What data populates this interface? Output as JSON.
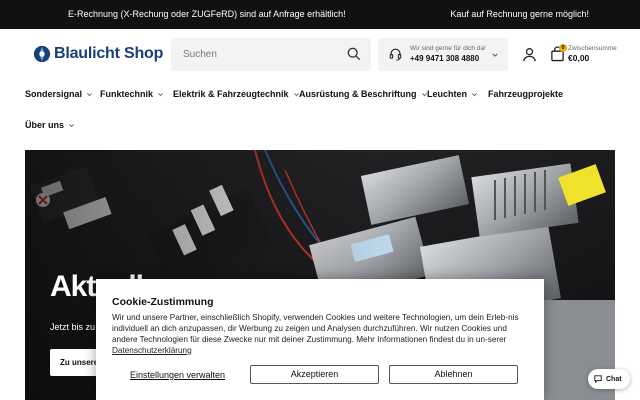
{
  "announcement": {
    "left": "E-Rechnung (X-Rechung oder ZUGFeRD) sind auf Anfrage erhältlich!",
    "right": "Kauf auf Rechnung gerne möglich!"
  },
  "header": {
    "logo_text": "Blaulicht Shop",
    "search_placeholder": "Suchen",
    "contact_label": "Wir sind gerne für dich da!",
    "contact_phone": "+49 9471 308 4880",
    "cart_badge": "0",
    "cart_label": "Zwischensumme",
    "cart_amount": "€0,00"
  },
  "nav": {
    "items": [
      {
        "label": "Sondersignal"
      },
      {
        "label": "Funktechnik"
      },
      {
        "label": "Elektrik & Fahrzeugtechnik"
      },
      {
        "label": "Ausrüstung & Beschriftung"
      },
      {
        "label": "Leuchten"
      },
      {
        "label": "Fahrzeugprojekte"
      },
      {
        "label": "Über uns"
      }
    ]
  },
  "hero": {
    "title": "Aktuelles",
    "subtitle": "Jetzt bis zu",
    "button_label": "Zu unseren Angeboten"
  },
  "cookie": {
    "title": "Cookie-Zustimmung",
    "text": "Wir und unsere Partner, einschließlich Shopify, verwenden Cookies und weitere Technologien, um dein Erleb-nis individuell an dich anzupassen, dir Werbung zu zeigen und Analysen durchzuführen. Wir nutzen Cookies und andere Technologien für diese Zwecke nur mit deiner Zustimmung. Mehr Informationen findest du in un-serer",
    "privacy_link": "Datenschutzerklärung",
    "settings_label": "Einstellungen verwalten",
    "accept_label": "Akzeptieren",
    "reject_label": "Ablehnen"
  },
  "chat": {
    "label": "Chat"
  },
  "colors": {
    "brand": "#1a3e7a",
    "accent": "#e8b10a",
    "topbar": "#111111"
  }
}
